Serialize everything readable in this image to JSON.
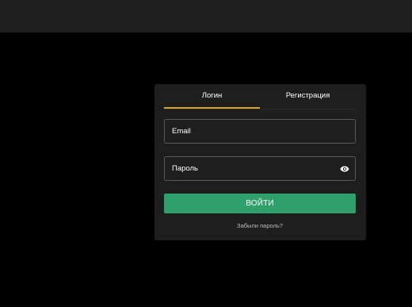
{
  "tabs": [
    {
      "label": "Логин",
      "active": true
    },
    {
      "label": "Регистрация",
      "active": false
    }
  ],
  "form": {
    "email_placeholder": "Email",
    "email_value": "",
    "password_placeholder": "Пароль",
    "password_value": "",
    "password_toggle_icon": "eye-icon",
    "submit_label": "ВОЙТИ",
    "forgot_label": "Забыли пароль?"
  },
  "colors": {
    "page_background": "#000000",
    "top_bar": "#1f1f1f",
    "card_background": "#1e1e1e",
    "active_tab_underline": "#d9a521",
    "submit_button": "#2f9f6b",
    "field_border": "#5a5a5a"
  }
}
